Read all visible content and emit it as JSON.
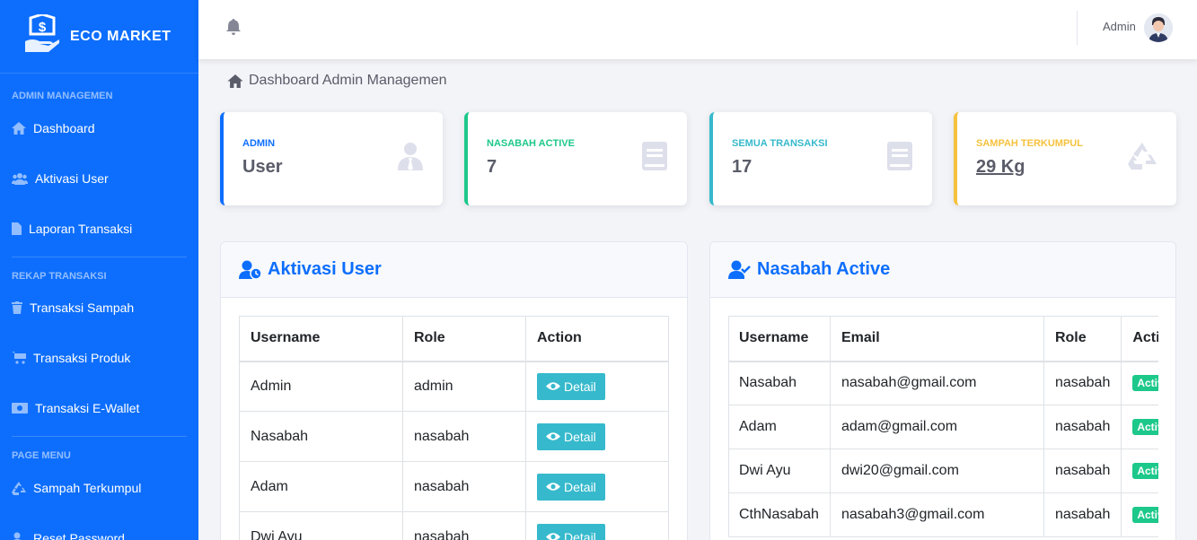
{
  "brand": {
    "name": "ECO MARKET"
  },
  "sidebar": {
    "headings": [
      "ADMIN MANAGEMEN",
      "REKAP TRANSAKSI",
      "PAGE MENU"
    ],
    "items": [
      {
        "label": "Dashboard",
        "icon": "home-icon"
      },
      {
        "label": "Aktivasi User",
        "icon": "users-icon"
      },
      {
        "label": "Laporan Transaksi",
        "icon": "file-icon"
      },
      {
        "label": "Transaksi Sampah",
        "icon": "trash-icon"
      },
      {
        "label": "Transaksi Produk",
        "icon": "cart-icon"
      },
      {
        "label": "Transaksi E-Wallet",
        "icon": "money-icon"
      },
      {
        "label": "Sampah Terkumpul",
        "icon": "recycle-icon"
      },
      {
        "label": "Reset Password",
        "icon": "user-lock-icon"
      }
    ]
  },
  "topbar": {
    "username": "Admin"
  },
  "breadcrumb": {
    "label": "Dashboard Admin Managemen"
  },
  "cards": [
    {
      "label": "ADMIN",
      "value": "User",
      "color": "#0d6efd",
      "icon": "user-tie-icon"
    },
    {
      "label": "NASABAH ACTIVE",
      "value": "7",
      "color": "#1cc88a",
      "icon": "book-icon"
    },
    {
      "label": "SEMUA TRANSAKSI",
      "value": "17",
      "color": "#36b9cc",
      "icon": "book-icon"
    },
    {
      "label": "SAMPAH TERKUMPUL",
      "value": "29 Kg",
      "color": "#f6c23e",
      "icon": "recycle-icon"
    }
  ],
  "aktivasi": {
    "title": "Aktivasi User",
    "columns": [
      "Username",
      "Role",
      "Action"
    ],
    "button_label": "Detail",
    "rows": [
      {
        "username": "Admin",
        "role": "admin"
      },
      {
        "username": "Nasabah",
        "role": "nasabah"
      },
      {
        "username": "Adam",
        "role": "nasabah"
      },
      {
        "username": "Dwi Ayu",
        "role": "nasabah"
      }
    ]
  },
  "nasabah": {
    "title": "Nasabah Active",
    "columns": [
      "Username",
      "Email",
      "Role",
      "Action"
    ],
    "badge_label": "Active",
    "rows": [
      {
        "username": "Nasabah",
        "email": "nasabah@gmail.com",
        "role": "nasabah"
      },
      {
        "username": "Adam",
        "email": "adam@gmail.com",
        "role": "nasabah"
      },
      {
        "username": "Dwi Ayu",
        "email": "dwi20@gmail.com",
        "role": "nasabah"
      },
      {
        "username": "CthNasabah",
        "email": "nasabah3@gmail.com",
        "role": "nasabah"
      }
    ]
  }
}
